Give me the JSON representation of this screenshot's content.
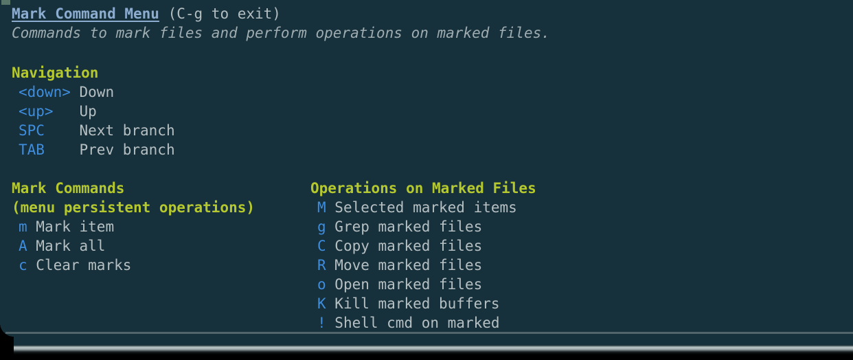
{
  "window": {
    "background_color": "#16303c",
    "title_color": "#8cadd0",
    "heading_color": "#b5c92e",
    "key_color": "#3f8ddd",
    "desc_color": "#b6c0c2"
  },
  "header": {
    "title": "Mark Command Menu",
    "exit_hint": "(C-g to exit)",
    "subtitle": "Commands to mark files and perform operations on marked files."
  },
  "sections": [
    {
      "heading": "Navigation",
      "subheading": null,
      "items": [
        {
          "key": "<down>",
          "key_pad": "<down> ",
          "label": "Down"
        },
        {
          "key": "<up>",
          "key_pad": "<up>   ",
          "label": "Up"
        },
        {
          "key": "SPC",
          "key_pad": "SPC    ",
          "label": "Next branch"
        },
        {
          "key": "TAB",
          "key_pad": "TAB    ",
          "label": "Prev branch"
        }
      ]
    },
    {
      "heading": "Mark Commands",
      "subheading": "(menu persistent operations)",
      "items": [
        {
          "key": "m",
          "key_pad": "m ",
          "label": "Mark item"
        },
        {
          "key": "A",
          "key_pad": "A ",
          "label": "Mark all"
        },
        {
          "key": "c",
          "key_pad": "c ",
          "label": "Clear marks"
        }
      ]
    },
    {
      "heading": "Operations on Marked Files",
      "subheading": null,
      "items": [
        {
          "key": "M",
          "key_pad": "M ",
          "label": "Selected marked items"
        },
        {
          "key": "g",
          "key_pad": "g ",
          "label": "Grep marked files"
        },
        {
          "key": "C",
          "key_pad": "C ",
          "label": "Copy marked files"
        },
        {
          "key": "R",
          "key_pad": "R ",
          "label": "Move marked files"
        },
        {
          "key": "o",
          "key_pad": "o ",
          "label": "Open marked files"
        },
        {
          "key": "K",
          "key_pad": "K ",
          "label": "Kill marked buffers"
        },
        {
          "key": "!",
          "key_pad": "! ",
          "label": "Shell cmd on marked"
        }
      ]
    }
  ]
}
